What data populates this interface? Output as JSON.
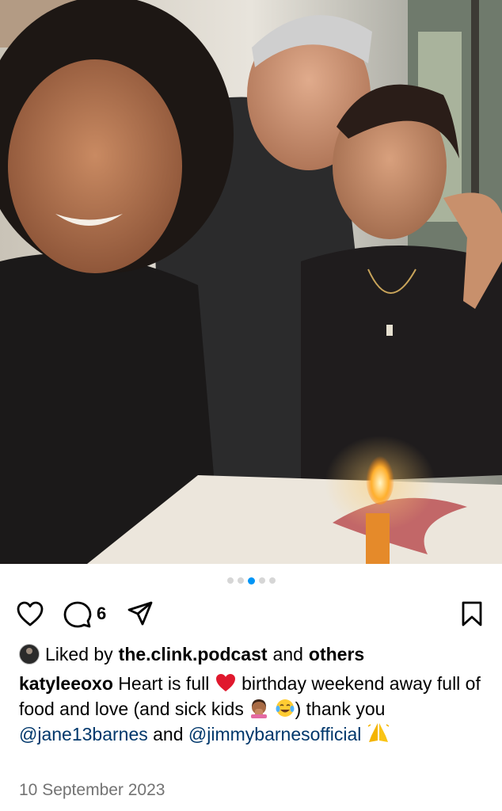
{
  "post": {
    "carousel": {
      "count": 5,
      "active_index": 2
    },
    "comment_count": "6",
    "likes": {
      "prefix": "Liked by",
      "user": "the.clink.podcast",
      "middle": "and",
      "suffix": "others"
    },
    "caption": {
      "username": "katyleeoxo",
      "text_1": "Heart is full",
      "text_2": "birthday weekend away full of food and love (and sick kids",
      "text_3": ")",
      "text_4": "thank you",
      "mention_1": "@jane13barnes",
      "text_5": "and",
      "mention_2": "@jimmybarnesofficial"
    },
    "date": "10 September 2023"
  },
  "icons": [
    "heart-icon",
    "comment-icon",
    "share-icon",
    "bookmark-icon"
  ],
  "colors": {
    "active_dot": "#0095f6",
    "inactive_dot": "#d6d6d6",
    "mention": "#00376b",
    "date": "#737373"
  }
}
